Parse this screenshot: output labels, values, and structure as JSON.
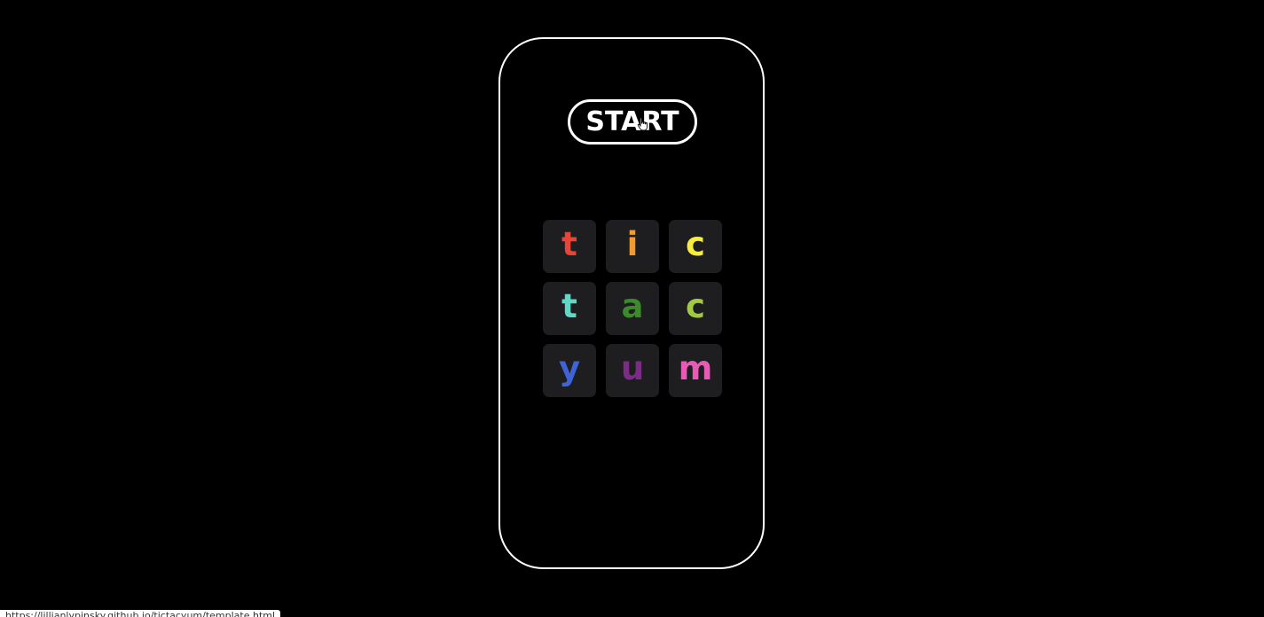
{
  "start_button": {
    "label": "START"
  },
  "board": {
    "tiles": [
      {
        "letter": "t",
        "color": "#e8453a"
      },
      {
        "letter": "i",
        "color": "#f39a2e"
      },
      {
        "letter": "c",
        "color": "#f7ee3c"
      },
      {
        "letter": "t",
        "color": "#5fd9c6"
      },
      {
        "letter": "a",
        "color": "#3d8a2c"
      },
      {
        "letter": "c",
        "color": "#a2c942"
      },
      {
        "letter": "y",
        "color": "#4064d6"
      },
      {
        "letter": "u",
        "color": "#7b2d86"
      },
      {
        "letter": "m",
        "color": "#e75bb4"
      }
    ]
  },
  "status_bar": {
    "url": "https://lillianlypinsky.github.io/tictacyum/template.html"
  },
  "colors": {
    "background": "#000000",
    "frame_border": "#ffffff",
    "tile_background": "#1e1e20"
  },
  "icons": {
    "cursor": "hand-pointer-icon"
  }
}
